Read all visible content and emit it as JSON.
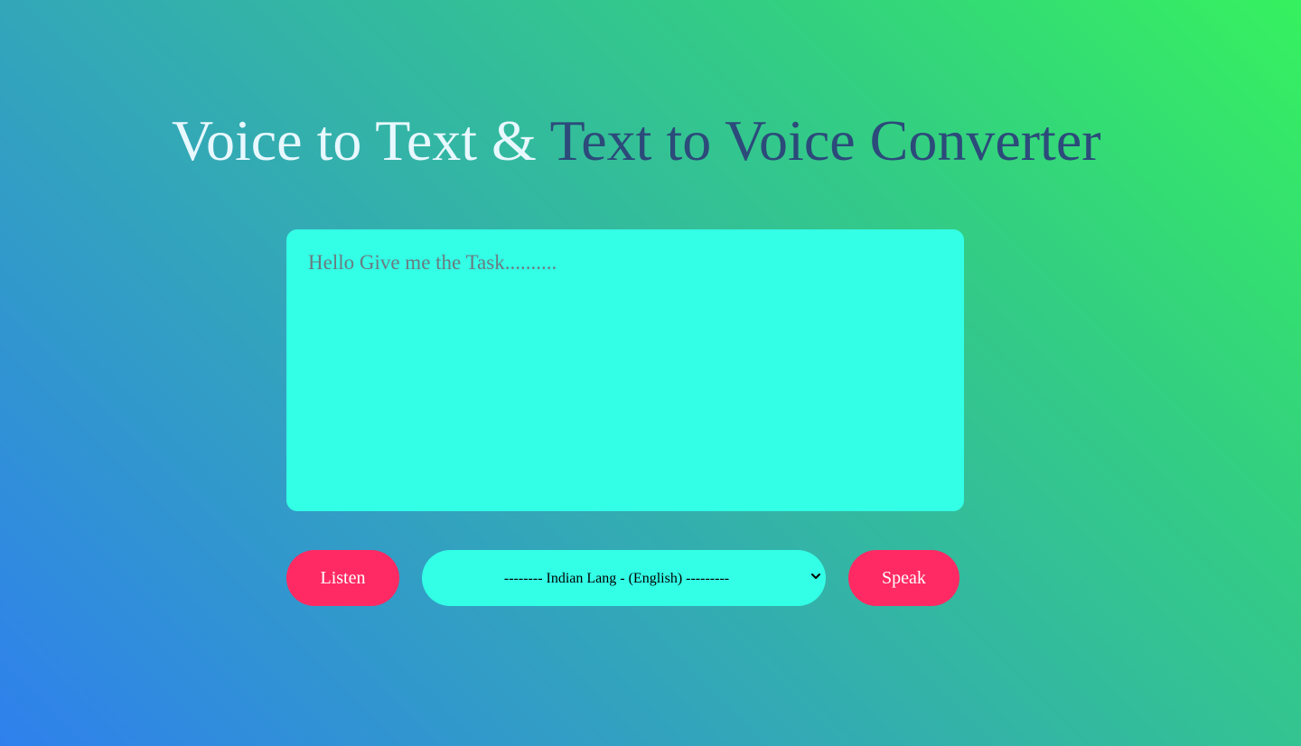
{
  "header": {
    "title_part_1": "Voice to Text & ",
    "title_part_2": "Text to Voice Converter"
  },
  "editor": {
    "placeholder": "Hello Give me the Task..........",
    "value": ""
  },
  "controls": {
    "listen_label": "Listen",
    "speak_label": "Speak",
    "language_selected": "-------- Indian Lang - (English) ---------"
  },
  "icons": {
    "dropdown": "chevron-down-icon"
  },
  "colors": {
    "button_bg": "#ff2a63",
    "input_bg": "#33ffe6",
    "title_light": "#e8f8ff",
    "title_dark": "#2c4a7a"
  }
}
